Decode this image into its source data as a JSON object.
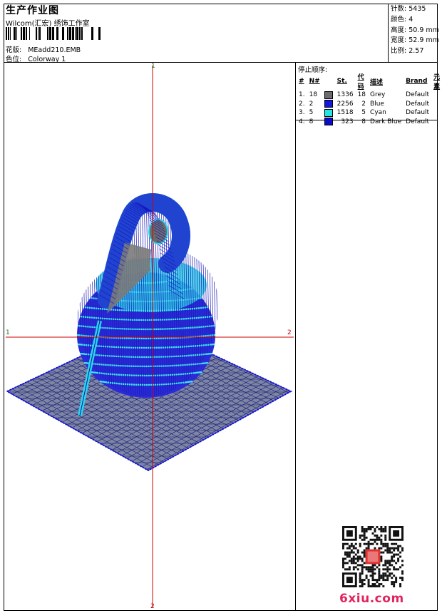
{
  "header": {
    "title": "生产作业图",
    "company": "Wilcom(汇宏) 绣饰工作室",
    "design_label": "花版:",
    "design_value": "MEadd210.EMB",
    "colorway_label": "色位:",
    "colorway_value": "Colorway 1"
  },
  "stats": [
    {
      "label": "针数:",
      "value": "5435"
    },
    {
      "label": "颜色:",
      "value": "4"
    },
    {
      "label": "高度:",
      "value": "50.9 mm"
    },
    {
      "label": "宽度:",
      "value": "52.9 mm"
    },
    {
      "label": "比例:",
      "value": "2.57"
    }
  ],
  "stop_sequence": {
    "title": "停止顺序:",
    "headers": [
      "#",
      "N#",
      "St.",
      "代码",
      "描述",
      "Brand",
      "元素"
    ],
    "rows": [
      {
        "idx": "1.",
        "n": "18",
        "color": "#6b6b6b",
        "st": "1336",
        "code": "18",
        "desc": "Grey",
        "brand": "Default"
      },
      {
        "idx": "2.",
        "n": "2",
        "color": "#1515e0",
        "st": "2256",
        "code": "2",
        "desc": "Blue",
        "brand": "Default"
      },
      {
        "idx": "3.",
        "n": "5",
        "color": "#22e6e6",
        "st": "1518",
        "code": "5",
        "desc": "Cyan",
        "brand": "Default"
      },
      {
        "idx": "4.",
        "n": "8",
        "color": "#0a0acc",
        "st": "323",
        "code": "8",
        "desc": "Dark Blue",
        "brand": "Default"
      }
    ]
  },
  "axes": {
    "top": "1",
    "bottom": "2",
    "left": "1",
    "right": "2"
  },
  "watermark": "6xiu.com"
}
